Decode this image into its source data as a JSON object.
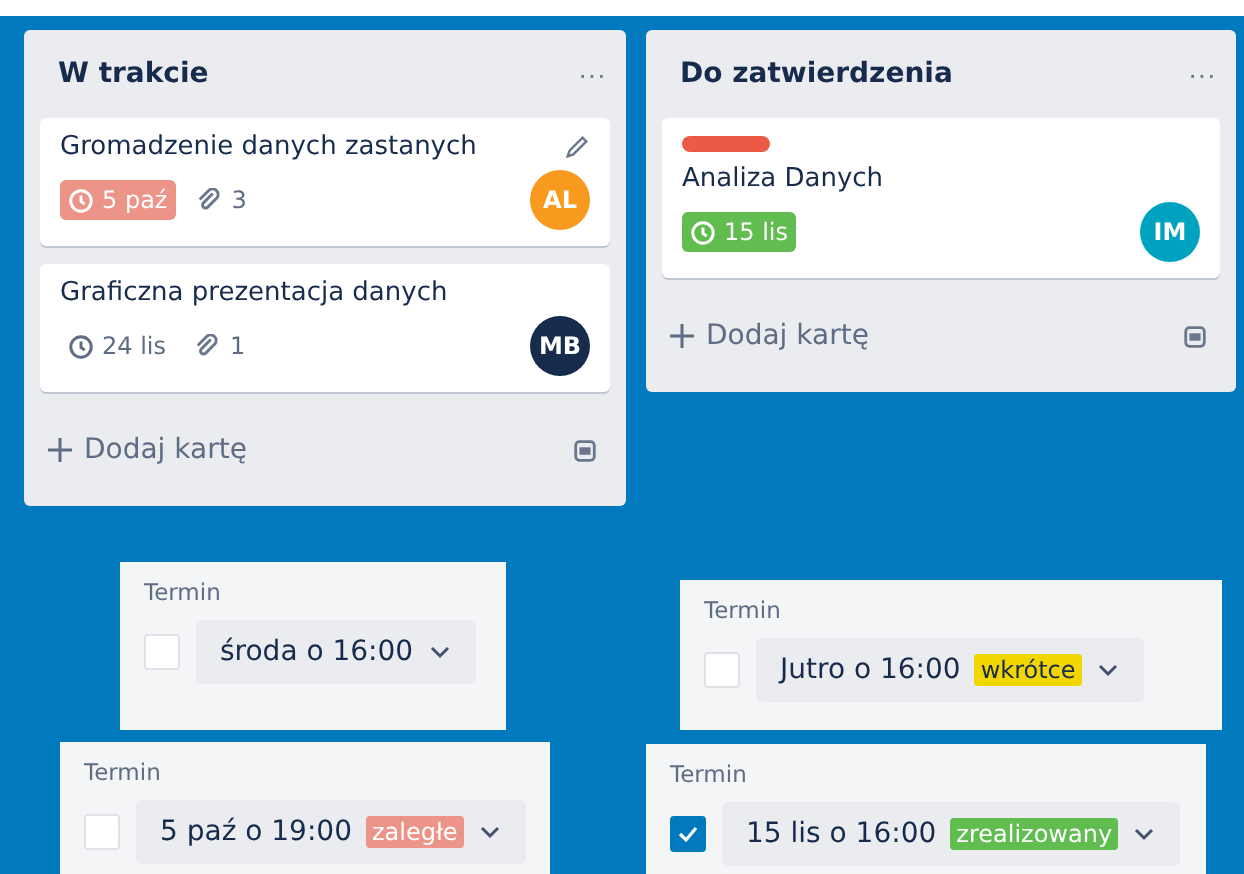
{
  "lists": [
    {
      "title": "W trakcie",
      "menu": "···",
      "cards": [
        {
          "title": "Gromadzenie danych zastanych",
          "editable": true,
          "due": {
            "text": "5 paź",
            "kind": "overdue"
          },
          "attachments": "3",
          "member": {
            "initials": "AL",
            "color": "#f79a1e"
          }
        },
        {
          "title": "Graficzna prezentacja danych",
          "editable": false,
          "due": {
            "text": "24 lis",
            "kind": "normal"
          },
          "attachments": "1",
          "member": {
            "initials": "MB",
            "color": "#172b4d"
          }
        }
      ],
      "add": "Dodaj kartę"
    },
    {
      "title": "Do zatwierdzenia",
      "menu": "···",
      "cards": [
        {
          "title": "Analiza Danych",
          "label": {
            "color": "#eb5a46"
          },
          "editable": false,
          "due": {
            "text": "15 lis",
            "kind": "done"
          },
          "member": {
            "initials": "IM",
            "color": "#00a3bf"
          }
        }
      ],
      "add": "Dodaj kartę"
    }
  ],
  "due_popups": [
    {
      "label": "Termin",
      "checked": false,
      "date": "środa o 16:00"
    },
    {
      "label": "Termin",
      "checked": false,
      "date": "Jutro o 16:00",
      "status": {
        "text": "wkrótce",
        "kind": "soon"
      }
    },
    {
      "label": "Termin",
      "checked": false,
      "date": "5 paź o 19:00",
      "status": {
        "text": "zaległe",
        "kind": "overdue"
      }
    },
    {
      "label": "Termin",
      "checked": true,
      "date": "15 lis o 16:00",
      "status": {
        "text": "zrealizowany",
        "kind": "done"
      }
    }
  ]
}
